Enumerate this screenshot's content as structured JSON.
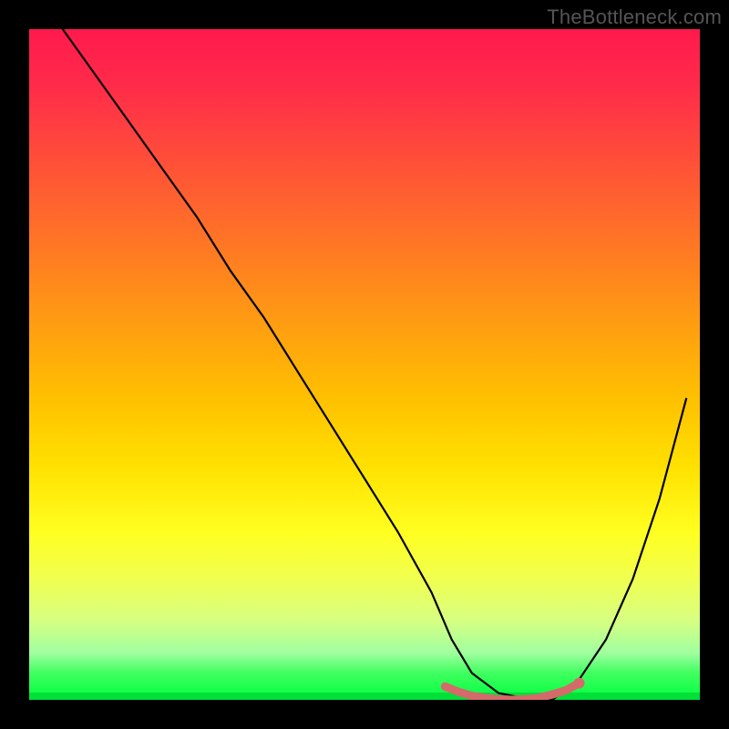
{
  "watermark": {
    "text": "TheBottleneck.com"
  },
  "chart_data": {
    "type": "line",
    "title": "",
    "xlabel": "",
    "ylabel": "",
    "xlim": [
      0,
      100
    ],
    "ylim": [
      0,
      100
    ],
    "gradient": {
      "top_color": "#ff1a4d",
      "bottom_color": "#00ff40",
      "direction": "vertical"
    },
    "series": [
      {
        "name": "bottleneck-curve",
        "x": [
          5,
          10,
          15,
          20,
          25,
          30,
          35,
          40,
          45,
          50,
          55,
          60,
          63,
          66,
          70,
          75,
          78,
          82,
          86,
          90,
          94,
          98
        ],
        "values": [
          100,
          93,
          86,
          79,
          72,
          64,
          57,
          49,
          41,
          33,
          25,
          16,
          9,
          4,
          1,
          0,
          0,
          3,
          9,
          18,
          30,
          45
        ]
      },
      {
        "name": "flat-minimum-marker",
        "color": "#d46a6a",
        "x": [
          62,
          64,
          66,
          68,
          70,
          72,
          74,
          76,
          78,
          80,
          82
        ],
        "values": [
          2.0,
          1.2,
          0.6,
          0.3,
          0.1,
          0.0,
          0.1,
          0.3,
          0.8,
          1.4,
          2.5
        ]
      }
    ],
    "annotations": []
  }
}
